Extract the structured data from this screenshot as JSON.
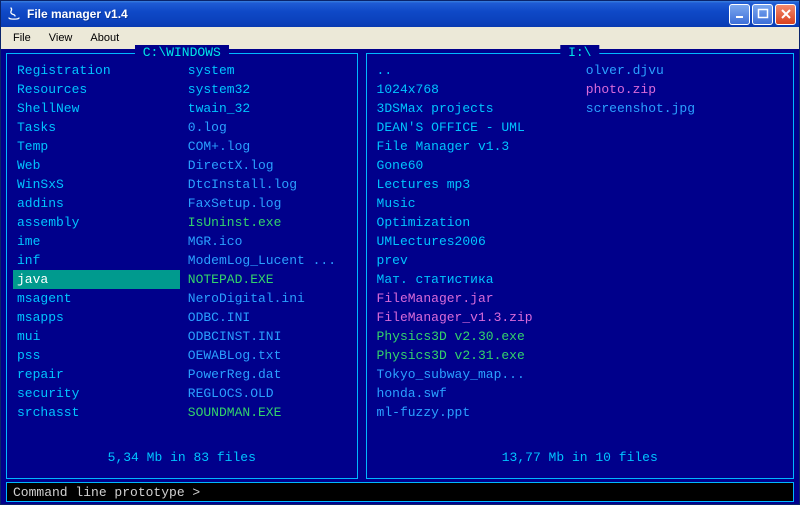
{
  "window": {
    "title": "File manager v1.4"
  },
  "menu": {
    "file": "File",
    "view": "View",
    "about": "About"
  },
  "cmd": {
    "prompt": "Command line prototype >"
  },
  "panes": {
    "left": {
      "title": "C:\\WINDOWS",
      "status": "5,34 Mb in 83 files",
      "cols": [
        [
          {
            "name": "Registration",
            "c": "c-folder"
          },
          {
            "name": "Resources",
            "c": "c-folder"
          },
          {
            "name": "ShellNew",
            "c": "c-folder"
          },
          {
            "name": "Tasks",
            "c": "c-folder"
          },
          {
            "name": "Temp",
            "c": "c-folder"
          },
          {
            "name": "Web",
            "c": "c-folder"
          },
          {
            "name": "WinSxS",
            "c": "c-folder"
          },
          {
            "name": "addins",
            "c": "c-folder"
          },
          {
            "name": "assembly",
            "c": "c-folder"
          },
          {
            "name": "ime",
            "c": "c-folder"
          },
          {
            "name": "inf",
            "c": "c-folder"
          },
          {
            "name": "java",
            "c": "c-folder",
            "selected": true
          },
          {
            "name": "msagent",
            "c": "c-folder"
          },
          {
            "name": "msapps",
            "c": "c-folder"
          },
          {
            "name": "mui",
            "c": "c-folder"
          },
          {
            "name": "pss",
            "c": "c-folder"
          },
          {
            "name": "repair",
            "c": "c-folder"
          },
          {
            "name": "security",
            "c": "c-folder"
          },
          {
            "name": "srchasst",
            "c": "c-folder"
          }
        ],
        [
          {
            "name": "system",
            "c": "c-folder"
          },
          {
            "name": "system32",
            "c": "c-folder"
          },
          {
            "name": "twain_32",
            "c": "c-folder"
          },
          {
            "name": "0.log",
            "c": "c-file"
          },
          {
            "name": "COM+.log",
            "c": "c-file"
          },
          {
            "name": "DirectX.log",
            "c": "c-file"
          },
          {
            "name": "DtcInstall.log",
            "c": "c-file"
          },
          {
            "name": "FaxSetup.log",
            "c": "c-file"
          },
          {
            "name": "IsUninst.exe",
            "c": "c-exe"
          },
          {
            "name": "MGR.ico",
            "c": "c-file"
          },
          {
            "name": "ModemLog_Lucent ...",
            "c": "c-file"
          },
          {
            "name": "NOTEPAD.EXE",
            "c": "c-exe"
          },
          {
            "name": "NeroDigital.ini",
            "c": "c-file"
          },
          {
            "name": "ODBC.INI",
            "c": "c-file"
          },
          {
            "name": "ODBCINST.INI",
            "c": "c-file"
          },
          {
            "name": "OEWABLog.txt",
            "c": "c-file"
          },
          {
            "name": "PowerReg.dat",
            "c": "c-file"
          },
          {
            "name": "REGLOCS.OLD",
            "c": "c-file"
          },
          {
            "name": "SOUNDMAN.EXE",
            "c": "c-exe"
          }
        ]
      ]
    },
    "right": {
      "title": "I:\\",
      "status": "13,77 Mb in 10 files",
      "cols": [
        [
          {
            "name": "..",
            "c": "c-folder"
          },
          {
            "name": "1024x768",
            "c": "c-folder"
          },
          {
            "name": "3DSMax projects",
            "c": "c-folder"
          },
          {
            "name": "DEAN'S OFFICE - UML",
            "c": "c-folder"
          },
          {
            "name": "File Manager v1.3",
            "c": "c-folder"
          },
          {
            "name": "Gone60",
            "c": "c-folder"
          },
          {
            "name": "Lectures mp3",
            "c": "c-folder"
          },
          {
            "name": "Music",
            "c": "c-folder"
          },
          {
            "name": "Optimization",
            "c": "c-folder"
          },
          {
            "name": "UMLectures2006",
            "c": "c-folder"
          },
          {
            "name": "prev",
            "c": "c-folder"
          },
          {
            "name": "Мат. статистика",
            "c": "c-folder"
          },
          {
            "name": "FileManager.jar",
            "c": "c-arch"
          },
          {
            "name": "FileManager_v1.3.zip",
            "c": "c-arch"
          },
          {
            "name": "Physics3D v2.30.exe",
            "c": "c-exe"
          },
          {
            "name": "Physics3D v2.31.exe",
            "c": "c-exe"
          },
          {
            "name": "Tokyo_subway_map...",
            "c": "c-file"
          },
          {
            "name": "honda.swf",
            "c": "c-file"
          },
          {
            "name": "ml-fuzzy.ppt",
            "c": "c-file"
          }
        ],
        [
          {
            "name": "olver.djvu",
            "c": "c-file"
          },
          {
            "name": "photo.zip",
            "c": "c-arch"
          },
          {
            "name": "screenshot.jpg",
            "c": "c-img"
          }
        ]
      ]
    }
  }
}
